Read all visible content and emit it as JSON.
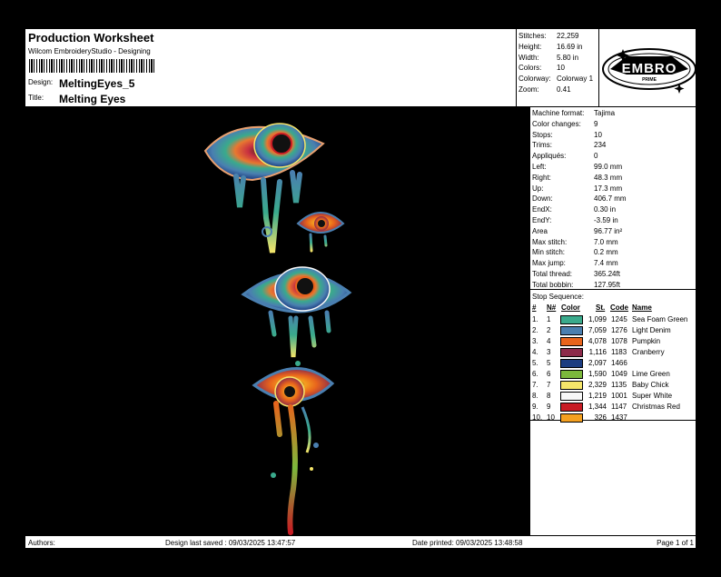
{
  "header": {
    "title": "Production Worksheet",
    "subtitle": "Wilcom EmbroideryStudio - Designing",
    "design_label": "Design:",
    "design_value": "MeltingEyes_5",
    "title_label": "Title:",
    "title_value": "Melting Eyes"
  },
  "summary": [
    {
      "label": "Stitches:",
      "value": "22,259"
    },
    {
      "label": "Height:",
      "value": "16.69 in"
    },
    {
      "label": "Width:",
      "value": "5.80 in"
    },
    {
      "label": "Colors:",
      "value": "10"
    },
    {
      "label": "Colorway:",
      "value": "Colorway 1"
    },
    {
      "label": "Zoom:",
      "value": "0.41"
    }
  ],
  "logo": {
    "main": "EMBRO",
    "sub": "PRIME"
  },
  "machine_info": [
    {
      "label": "Machine format:",
      "value": "Tajima"
    },
    {
      "label": "Color changes:",
      "value": "9"
    },
    {
      "label": "Stops:",
      "value": "10"
    },
    {
      "label": "Trims:",
      "value": "234"
    },
    {
      "label": "Appliqués:",
      "value": "0"
    },
    {
      "label": "Left:",
      "value": "99.0 mm"
    },
    {
      "label": "Right:",
      "value": "48.3 mm"
    },
    {
      "label": "Up:",
      "value": "17.3 mm"
    },
    {
      "label": "Down:",
      "value": "406.7 mm"
    },
    {
      "label": "EndX:",
      "value": "0.30 in"
    },
    {
      "label": "EndY:",
      "value": "-3.59 in"
    },
    {
      "label": "Area",
      "value": "96.77 in²"
    },
    {
      "label": "Max stitch:",
      "value": "7.0 mm"
    },
    {
      "label": "Min stitch:",
      "value": "0.2 mm"
    },
    {
      "label": "Max jump:",
      "value": "7.4 mm"
    },
    {
      "label": "Total thread:",
      "value": "365.24ft"
    },
    {
      "label": "Total bobbin:",
      "value": "127.95ft"
    }
  ],
  "stop_sequence": {
    "caption": "Stop Sequence:",
    "headers": {
      "num": "#",
      "n": "N#",
      "color": "Color",
      "st": "St.",
      "code": "Code",
      "name": "Name"
    },
    "rows": [
      {
        "num": "1.",
        "n": "1",
        "color": "#3aaa8c",
        "st": "1,099",
        "code": "1245",
        "name": "Sea Foam Green"
      },
      {
        "num": "2.",
        "n": "2",
        "color": "#4a7fb0",
        "st": "7,059",
        "code": "1276",
        "name": "Light Denim"
      },
      {
        "num": "3.",
        "n": "4",
        "color": "#e8641c",
        "st": "4,078",
        "code": "1078",
        "name": "Pumpkin"
      },
      {
        "num": "4.",
        "n": "3",
        "color": "#8c2a4a",
        "st": "1,116",
        "code": "1183",
        "name": "Cranberry"
      },
      {
        "num": "5.",
        "n": "5",
        "color": "#1c3c80",
        "st": "2,097",
        "code": "1466",
        "name": ""
      },
      {
        "num": "6.",
        "n": "6",
        "color": "#7cb83c",
        "st": "1,590",
        "code": "1049",
        "name": "Lime Green"
      },
      {
        "num": "7.",
        "n": "7",
        "color": "#f6e66a",
        "st": "2,329",
        "code": "1135",
        "name": "Baby Chick"
      },
      {
        "num": "8.",
        "n": "8",
        "color": "#f8f8f8",
        "st": "1,219",
        "code": "1001",
        "name": "Super White"
      },
      {
        "num": "9.",
        "n": "9",
        "color": "#c81c24",
        "st": "1,344",
        "code": "1147",
        "name": "Christmas Red"
      },
      {
        "num": "10.",
        "n": "10",
        "color": "#f4a020",
        "st": "326",
        "code": "1437",
        "name": ""
      }
    ]
  },
  "footer": {
    "authors": "Authors:",
    "saved": "Design last saved : 09/03/2025 13:47:57",
    "printed": "Date printed: 09/03/2025 13:48:58",
    "page": "Page 1 of 1"
  }
}
